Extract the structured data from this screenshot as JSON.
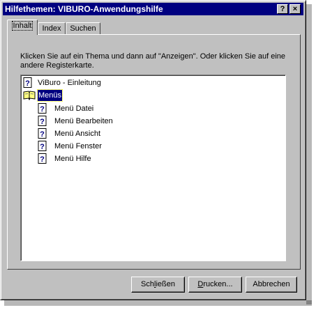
{
  "window": {
    "title": "Hilfethemen: VIBURO-Anwendungshilfe",
    "help_button": "?",
    "close_button": "×"
  },
  "tabs": [
    {
      "label": "Inhalt",
      "active": true
    },
    {
      "label": "Index",
      "active": false
    },
    {
      "label": "Suchen",
      "active": false
    }
  ],
  "instruction": "Klicken Sie auf ein Thema und dann auf \"Anzeigen\". Oder klicken Sie auf eine andere Registerkarte.",
  "tree": [
    {
      "label": "ViBuro - Einleitung",
      "icon": "help-topic-icon",
      "level": 0
    },
    {
      "label": "Menüs",
      "icon": "open-book-icon",
      "level": 0,
      "selected": true
    },
    {
      "label": "Menü Datei",
      "icon": "help-topic-icon",
      "level": 1
    },
    {
      "label": "Menü Bearbeiten",
      "icon": "help-topic-icon",
      "level": 1
    },
    {
      "label": "Menü Ansicht",
      "icon": "help-topic-icon",
      "level": 1
    },
    {
      "label": "Menü Fenster",
      "icon": "help-topic-icon",
      "level": 1
    },
    {
      "label": "Menü Hilfe",
      "icon": "help-topic-icon",
      "level": 1
    }
  ],
  "buttons": {
    "close": {
      "before": "Sch",
      "mnemonic": "l",
      "after": "ießen"
    },
    "print": {
      "before": "",
      "mnemonic": "D",
      "after": "rucken..."
    },
    "cancel": {
      "label": "Abbrechen"
    }
  },
  "colors": {
    "titlebar": "#000080",
    "face": "#c0c0c0",
    "selection": "#000080"
  }
}
